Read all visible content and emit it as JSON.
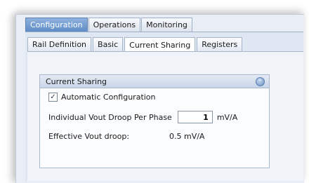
{
  "top_tabs": [
    "Configuration",
    "Operations",
    "Monitoring"
  ],
  "sub_tabs": [
    "Rail Definition",
    "Basic",
    "Current Sharing",
    "Registers"
  ],
  "group": {
    "title": "Current Sharing",
    "auto_config_label": "Automatic Configuration",
    "auto_config_checked": true,
    "droop_label": "Individual Vout Droop Per Phase",
    "droop_value": "1",
    "droop_unit": "mV/A",
    "effective_label": "Effective Vout droop:",
    "effective_value": "0.5 mV/A"
  },
  "icons": {
    "collapse": "collapse-icon",
    "check": "checkmark-icon"
  },
  "colors": {
    "active_tab": "#5f8cc6",
    "panel": "#e9eef6"
  }
}
